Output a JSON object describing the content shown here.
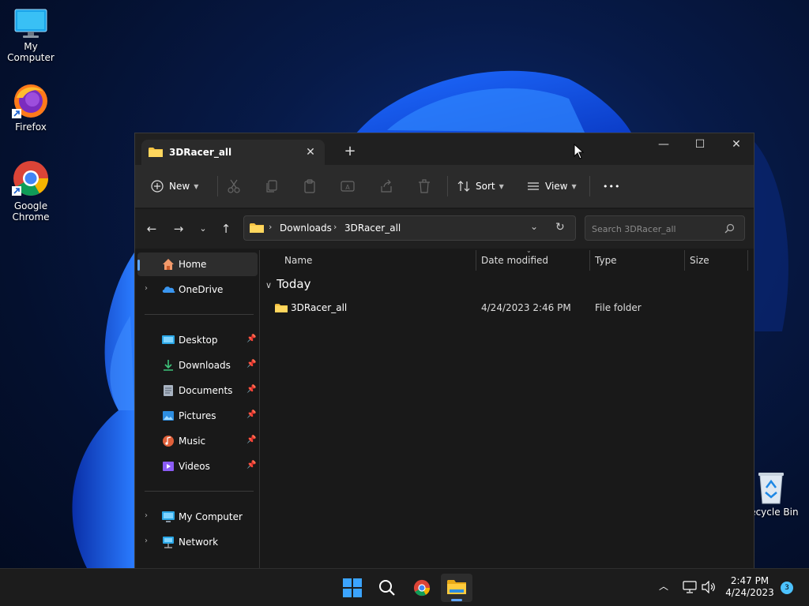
{
  "desktop": {
    "icons": [
      {
        "label": "My Computer",
        "icon": "monitor-icon"
      },
      {
        "label": "Firefox",
        "icon": "firefox-icon"
      },
      {
        "label": "Google Chrome",
        "icon": "chrome-icon"
      },
      {
        "label": "Recycle Bin",
        "icon": "recycle-bin-icon"
      }
    ]
  },
  "window": {
    "tab_title": "3DRacer_all",
    "tab_close": "✕",
    "new_tab": "+",
    "controls": {
      "minimize": "—",
      "maximize": "☐",
      "close": "✕"
    },
    "toolbar": {
      "new_label": "New",
      "sort_label": "Sort",
      "view_label": "View",
      "more_label": "•••"
    },
    "address": {
      "breadcrumbs": [
        "Downloads",
        "3DRacer_all"
      ],
      "search_placeholder": "Search 3DRacer_all"
    },
    "nav": {
      "items": [
        {
          "label": "Home",
          "icon": "home-icon"
        },
        {
          "label": "OneDrive",
          "icon": "onedrive-icon"
        },
        {
          "label": "Desktop",
          "icon": "desktop-icon"
        },
        {
          "label": "Downloads",
          "icon": "download-icon"
        },
        {
          "label": "Documents",
          "icon": "documents-icon"
        },
        {
          "label": "Pictures",
          "icon": "pictures-icon"
        },
        {
          "label": "Music",
          "icon": "music-icon"
        },
        {
          "label": "Videos",
          "icon": "videos-icon"
        },
        {
          "label": "My Computer",
          "icon": "computer-icon"
        },
        {
          "label": "Network",
          "icon": "network-icon"
        }
      ]
    },
    "columns": [
      "Name",
      "Date modified",
      "Type",
      "Size"
    ],
    "group_label": "Today",
    "files": [
      {
        "name": "3DRacer_all",
        "date_modified": "4/24/2023 2:46 PM",
        "type": "File folder",
        "size": ""
      }
    ]
  },
  "taskbar": {
    "time": "2:47 PM",
    "date": "4/24/2023",
    "notification_count": "3"
  },
  "colors": {
    "accent": "#60a5fa",
    "folder": "#f6c343",
    "window_bg": "#191919",
    "toolbar_bg": "#2b2b2b"
  }
}
